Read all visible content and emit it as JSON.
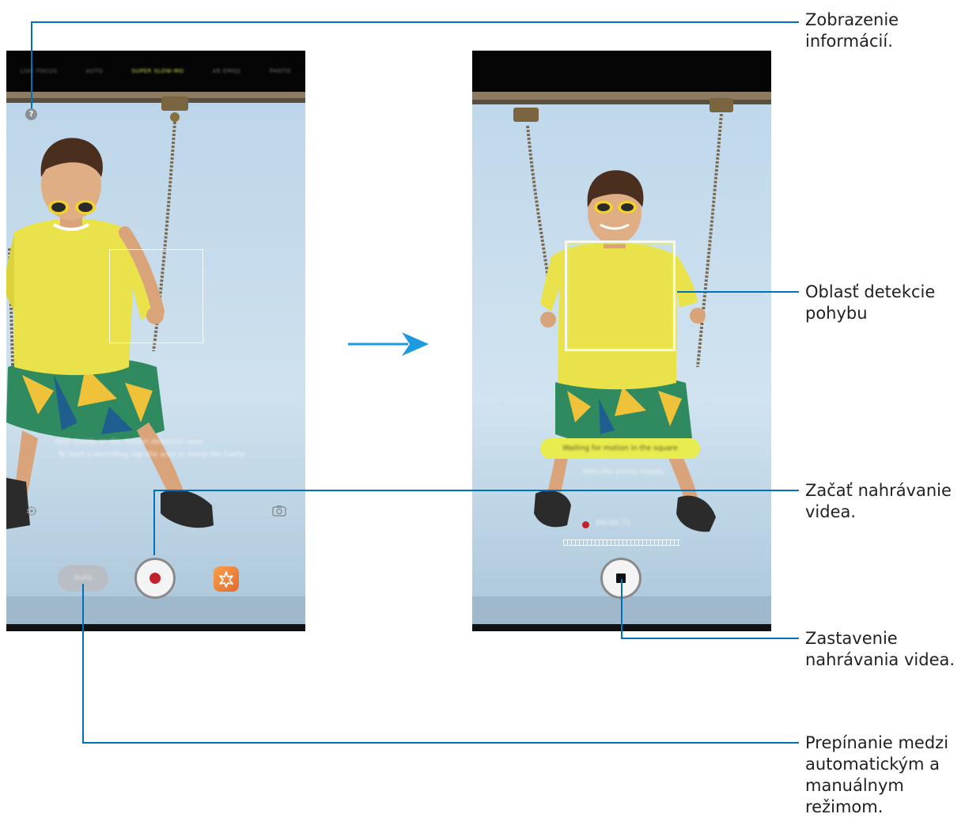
{
  "left_phone": {
    "modes": [
      "LIVE FOCUS",
      "AUTO",
      "SUPER SLOW-MO",
      "AR EMOJI",
      "PHOTO"
    ],
    "active_mode_index": 2,
    "help_icon_glyph": "?",
    "hint_line1": "Hold steady on the motion detection area.",
    "hint_line2": "To start a recording, tap the area or move the frame.",
    "auto_label": "Auto",
    "record_icon": "record-icon",
    "effects_icon": "effects-icon",
    "settings_icon": "gear-icon",
    "switch_camera_icon": "switch-camera-icon"
  },
  "right_phone": {
    "waiting_message": "Waiting for motion in the square",
    "hint": "Hold the phone steady.",
    "timer": "00:00:71",
    "stop_icon": "stop-icon"
  },
  "arrow_icon": "arrow-right-icon",
  "callouts": {
    "info": {
      "line1": "Zobrazenie",
      "line2": "informácií."
    },
    "detection": {
      "line1": "Oblasť detekcie",
      "line2": "pohybu"
    },
    "start": {
      "line1": "Začať nahrávanie",
      "line2": "videa."
    },
    "stop": {
      "line1": "Zastavenie",
      "line2": "nahrávania videa."
    },
    "switch": {
      "line1": "Prepínanie medzi",
      "line2": "automatickým a",
      "line3": "manuálnym",
      "line4": "režimom."
    }
  },
  "colors": {
    "callout_line": "#0072bc",
    "arrow": "#1e9be0",
    "record_red": "#c2202a",
    "message_yellow": "#e9ec4f"
  }
}
